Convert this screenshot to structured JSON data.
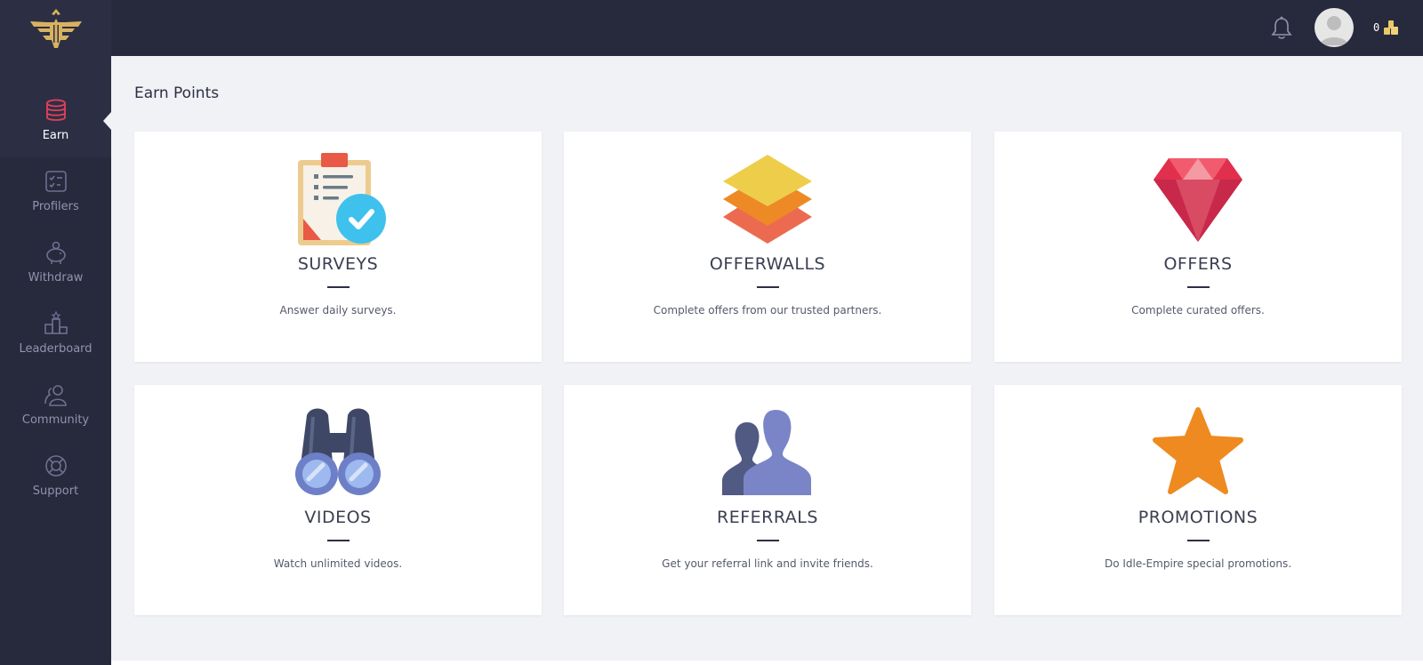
{
  "header": {
    "balance": "0"
  },
  "sidebar": {
    "items": [
      {
        "label": "Earn",
        "icon": "coins-icon",
        "active": true
      },
      {
        "label": "Profilers",
        "icon": "checklist-icon"
      },
      {
        "label": "Withdraw",
        "icon": "piggy-bank-icon"
      },
      {
        "label": "Leaderboard",
        "icon": "trophy-icon"
      },
      {
        "label": "Community",
        "icon": "users-icon"
      },
      {
        "label": "Support",
        "icon": "lifebuoy-icon"
      }
    ]
  },
  "main": {
    "title": "Earn Points",
    "cards": [
      {
        "title": "SURVEYS",
        "desc": "Answer daily surveys.",
        "icon": "clipboard-check-icon"
      },
      {
        "title": "OFFERWALLS",
        "desc": "Complete offers from our trusted partners.",
        "icon": "layers-icon"
      },
      {
        "title": "OFFERS",
        "desc": "Complete curated offers.",
        "icon": "diamond-icon"
      },
      {
        "title": "VIDEOS",
        "desc": "Watch unlimited videos.",
        "icon": "binoculars-icon"
      },
      {
        "title": "REFERRALS",
        "desc": "Get your referral link and invite friends.",
        "icon": "people-icon"
      },
      {
        "title": "PROMOTIONS",
        "desc": "Do Idle-Empire special promotions.",
        "icon": "star-icon"
      }
    ]
  },
  "colors": {
    "sidebar_bg": "#272a3d",
    "content_bg": "#f1f2f6",
    "logo_gold": "#d9b260",
    "active_icon": "#e3405a"
  }
}
